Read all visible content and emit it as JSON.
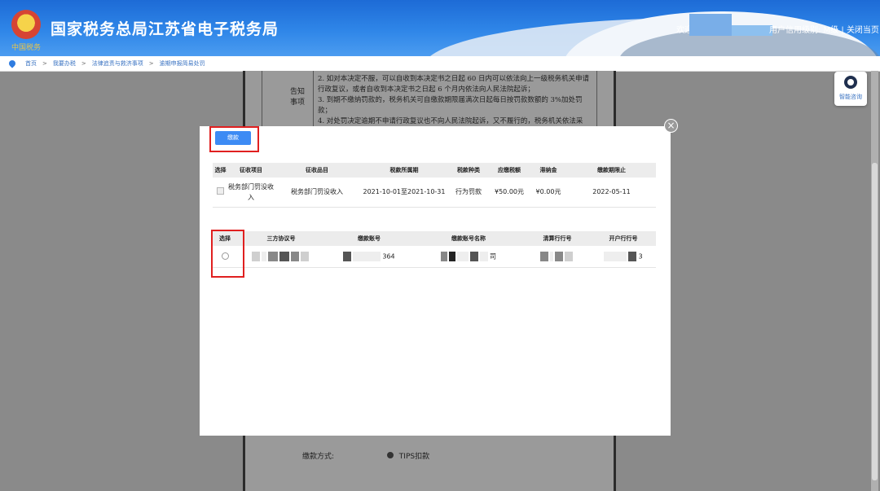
{
  "header": {
    "site_title": "国家税务总局江苏省电子税务局",
    "logo_subtext": "中国税务",
    "welcome": "欢迎",
    "credit_info": "用户信用级别: M级",
    "close_link": "关闭当页",
    "separator": "|",
    "colors": {
      "header_blue": "#2f86e8",
      "title_text": "#ffffff"
    }
  },
  "breadcrumb": {
    "items": [
      "首页",
      "我要办税",
      "法律追责与救济事项",
      "逾期申报简易处罚"
    ],
    "separator": ">"
  },
  "background_doc": {
    "label": "告知事项",
    "lines": [
      "2. 如对本决定不服，可以自收到本决定书之日起 60 日内可以依法向上一级税务机关申请行政复议，或者自收到本决定书之日起 6 个月内依法向人民法院起诉；",
      "3. 到期不缴纳罚款的，税务机关可自缴款期限届满次日起每日按罚款数额的 3%加处罚款；",
      "4. 对处罚决定逾期不申请行政复议也不向人民法院起诉，又不履行的，税务机关依法采"
    ]
  },
  "help": {
    "label": "智能咨询"
  },
  "payment_method": {
    "label": "缴款方式:",
    "value": "TIPS扣款"
  },
  "modal": {
    "pay_button_label": "缴款",
    "close_symbol": "×",
    "tax_table": {
      "headers": [
        "选择",
        "征收项目",
        "征收品目",
        "税款所属期",
        "税款种类",
        "应缴税额",
        "滞纳金",
        "缴款期限止"
      ],
      "rows": [
        {
          "item": "税务部门罚没收入",
          "subitem": "税务部门罚没收入",
          "period": "2021-10-01至2021-10-31",
          "type": "行为罚款",
          "amount": "¥50.00元",
          "late_fee": "¥0.00元",
          "deadline": "2022-05-11"
        }
      ]
    },
    "account_table": {
      "headers": [
        "选择",
        "三方协议号",
        "缴款账号",
        "缴款账号名称",
        "清算行行号",
        "开户行行号"
      ],
      "rows": [
        {
          "agreement_no": "",
          "account_no_suffix": "364",
          "account_name_suffix": "司",
          "clearing_bank_no": "",
          "bank_no_suffix": "3"
        }
      ]
    }
  },
  "colors": {
    "highlight_red": "#e02020",
    "button_blue": "#3d8bf4",
    "overlay_gray": "#8a8a8a"
  }
}
